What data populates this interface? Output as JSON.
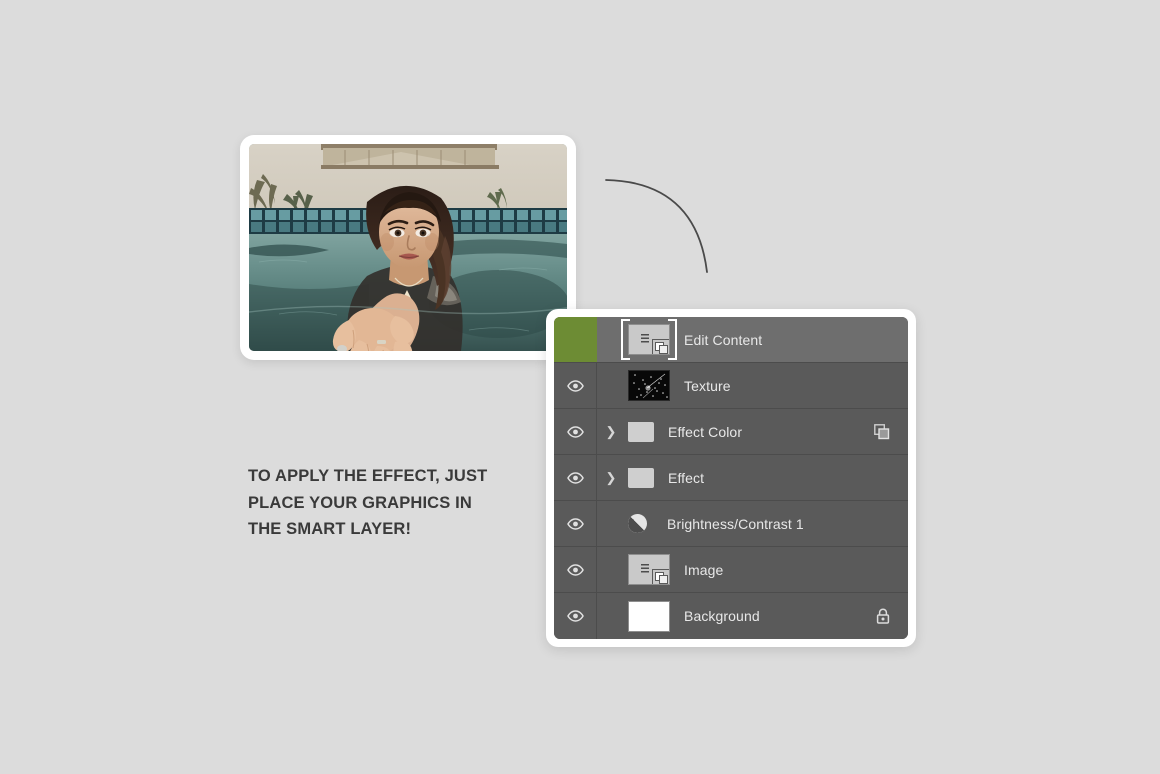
{
  "background_color": "#dcdcdc",
  "caption": {
    "lines": [
      "TO APPLY THE EFFECT, JUST",
      "PLACE YOUR GRAPHICS IN",
      "THE SMART LAYER!"
    ],
    "color": "#3a3a3a"
  },
  "photo_card": {
    "alt": "woman in swimming pool reaching hand toward camera",
    "frame_color": "#ffffff"
  },
  "connector": {
    "shape": "quarter-arc-curve",
    "color": "#4a4a4a"
  },
  "layers_panel": {
    "frame_color": "#ffffff",
    "panel_background": "#5a5a5a",
    "selected_row_background": "#6e6e6e",
    "accent_color": "#6d8c34",
    "text_color": "#e8e8e8",
    "rows": [
      {
        "name": "Edit Content",
        "selected": true,
        "visible": true,
        "eye_icon": "eye-icon",
        "thumb_type": "smart-object",
        "badge": "smart-object-badge",
        "chevron": false,
        "right_icon": ""
      },
      {
        "name": "Texture",
        "selected": false,
        "visible": true,
        "eye_icon": "eye-icon",
        "thumb_type": "texture",
        "badge": "",
        "chevron": false,
        "right_icon": ""
      },
      {
        "name": "Effect Color",
        "selected": false,
        "visible": true,
        "eye_icon": "eye-icon",
        "thumb_type": "folder",
        "badge": "",
        "chevron": true,
        "right_icon": "smart-filter-icon"
      },
      {
        "name": "Effect",
        "selected": false,
        "visible": true,
        "eye_icon": "eye-icon",
        "thumb_type": "folder",
        "badge": "",
        "chevron": true,
        "right_icon": ""
      },
      {
        "name": "Brightness/Contrast 1",
        "selected": false,
        "visible": true,
        "eye_icon": "eye-icon",
        "thumb_type": "adjustment",
        "badge": "",
        "chevron": false,
        "right_icon": ""
      },
      {
        "name": "Image",
        "selected": false,
        "visible": true,
        "eye_icon": "eye-icon",
        "thumb_type": "smart-object",
        "badge": "smart-object-badge",
        "chevron": false,
        "right_icon": ""
      },
      {
        "name": "Background",
        "selected": false,
        "visible": true,
        "eye_icon": "eye-icon",
        "thumb_type": "white",
        "badge": "",
        "chevron": false,
        "right_icon": "lock-icon"
      }
    ]
  }
}
